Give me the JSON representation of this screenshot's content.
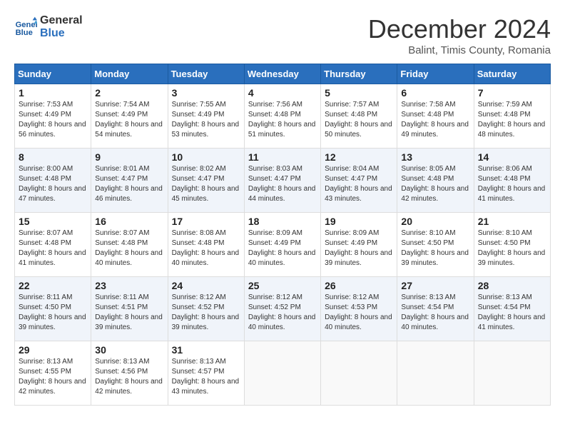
{
  "header": {
    "logo_line1": "General",
    "logo_line2": "Blue",
    "month_title": "December 2024",
    "subtitle": "Balint, Timis County, Romania"
  },
  "weekdays": [
    "Sunday",
    "Monday",
    "Tuesday",
    "Wednesday",
    "Thursday",
    "Friday",
    "Saturday"
  ],
  "weeks": [
    [
      {
        "day": "1",
        "sunrise": "7:53 AM",
        "sunset": "4:49 PM",
        "daylight": "8 hours and 56 minutes."
      },
      {
        "day": "2",
        "sunrise": "7:54 AM",
        "sunset": "4:49 PM",
        "daylight": "8 hours and 54 minutes."
      },
      {
        "day": "3",
        "sunrise": "7:55 AM",
        "sunset": "4:49 PM",
        "daylight": "8 hours and 53 minutes."
      },
      {
        "day": "4",
        "sunrise": "7:56 AM",
        "sunset": "4:48 PM",
        "daylight": "8 hours and 51 minutes."
      },
      {
        "day": "5",
        "sunrise": "7:57 AM",
        "sunset": "4:48 PM",
        "daylight": "8 hours and 50 minutes."
      },
      {
        "day": "6",
        "sunrise": "7:58 AM",
        "sunset": "4:48 PM",
        "daylight": "8 hours and 49 minutes."
      },
      {
        "day": "7",
        "sunrise": "7:59 AM",
        "sunset": "4:48 PM",
        "daylight": "8 hours and 48 minutes."
      }
    ],
    [
      {
        "day": "8",
        "sunrise": "8:00 AM",
        "sunset": "4:48 PM",
        "daylight": "8 hours and 47 minutes."
      },
      {
        "day": "9",
        "sunrise": "8:01 AM",
        "sunset": "4:47 PM",
        "daylight": "8 hours and 46 minutes."
      },
      {
        "day": "10",
        "sunrise": "8:02 AM",
        "sunset": "4:47 PM",
        "daylight": "8 hours and 45 minutes."
      },
      {
        "day": "11",
        "sunrise": "8:03 AM",
        "sunset": "4:47 PM",
        "daylight": "8 hours and 44 minutes."
      },
      {
        "day": "12",
        "sunrise": "8:04 AM",
        "sunset": "4:47 PM",
        "daylight": "8 hours and 43 minutes."
      },
      {
        "day": "13",
        "sunrise": "8:05 AM",
        "sunset": "4:48 PM",
        "daylight": "8 hours and 42 minutes."
      },
      {
        "day": "14",
        "sunrise": "8:06 AM",
        "sunset": "4:48 PM",
        "daylight": "8 hours and 41 minutes."
      }
    ],
    [
      {
        "day": "15",
        "sunrise": "8:07 AM",
        "sunset": "4:48 PM",
        "daylight": "8 hours and 41 minutes."
      },
      {
        "day": "16",
        "sunrise": "8:07 AM",
        "sunset": "4:48 PM",
        "daylight": "8 hours and 40 minutes."
      },
      {
        "day": "17",
        "sunrise": "8:08 AM",
        "sunset": "4:48 PM",
        "daylight": "8 hours and 40 minutes."
      },
      {
        "day": "18",
        "sunrise": "8:09 AM",
        "sunset": "4:49 PM",
        "daylight": "8 hours and 40 minutes."
      },
      {
        "day": "19",
        "sunrise": "8:09 AM",
        "sunset": "4:49 PM",
        "daylight": "8 hours and 39 minutes."
      },
      {
        "day": "20",
        "sunrise": "8:10 AM",
        "sunset": "4:50 PM",
        "daylight": "8 hours and 39 minutes."
      },
      {
        "day": "21",
        "sunrise": "8:10 AM",
        "sunset": "4:50 PM",
        "daylight": "8 hours and 39 minutes."
      }
    ],
    [
      {
        "day": "22",
        "sunrise": "8:11 AM",
        "sunset": "4:50 PM",
        "daylight": "8 hours and 39 minutes."
      },
      {
        "day": "23",
        "sunrise": "8:11 AM",
        "sunset": "4:51 PM",
        "daylight": "8 hours and 39 minutes."
      },
      {
        "day": "24",
        "sunrise": "8:12 AM",
        "sunset": "4:52 PM",
        "daylight": "8 hours and 39 minutes."
      },
      {
        "day": "25",
        "sunrise": "8:12 AM",
        "sunset": "4:52 PM",
        "daylight": "8 hours and 40 minutes."
      },
      {
        "day": "26",
        "sunrise": "8:12 AM",
        "sunset": "4:53 PM",
        "daylight": "8 hours and 40 minutes."
      },
      {
        "day": "27",
        "sunrise": "8:13 AM",
        "sunset": "4:54 PM",
        "daylight": "8 hours and 40 minutes."
      },
      {
        "day": "28",
        "sunrise": "8:13 AM",
        "sunset": "4:54 PM",
        "daylight": "8 hours and 41 minutes."
      }
    ],
    [
      {
        "day": "29",
        "sunrise": "8:13 AM",
        "sunset": "4:55 PM",
        "daylight": "8 hours and 42 minutes."
      },
      {
        "day": "30",
        "sunrise": "8:13 AM",
        "sunset": "4:56 PM",
        "daylight": "8 hours and 42 minutes."
      },
      {
        "day": "31",
        "sunrise": "8:13 AM",
        "sunset": "4:57 PM",
        "daylight": "8 hours and 43 minutes."
      },
      null,
      null,
      null,
      null
    ]
  ]
}
